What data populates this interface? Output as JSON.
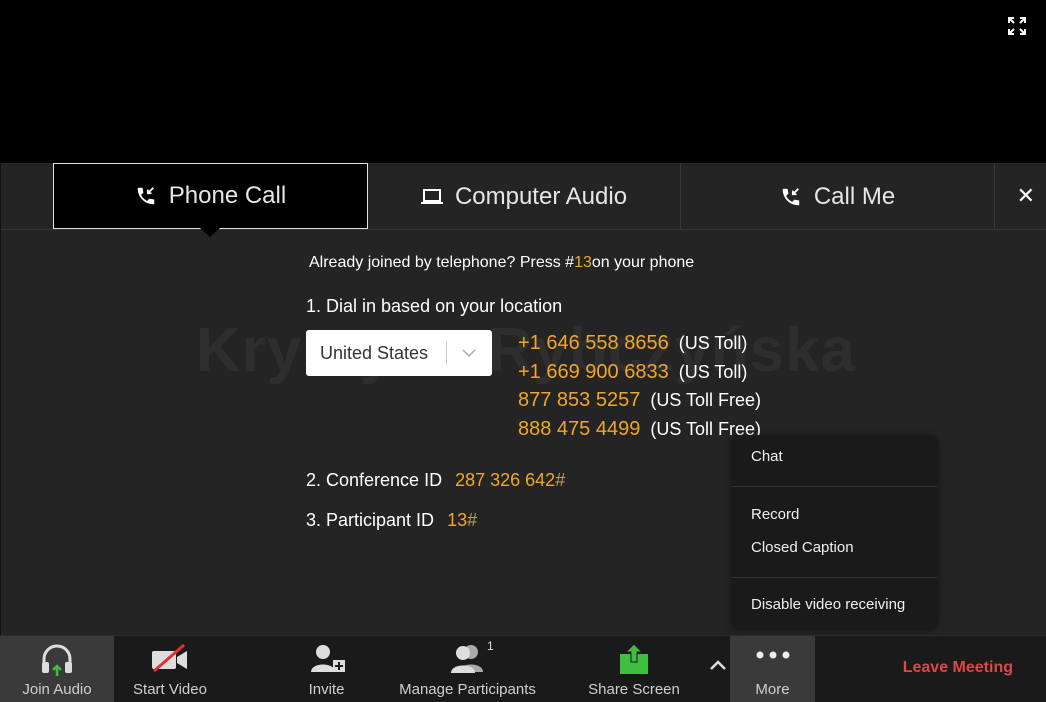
{
  "tabs": {
    "phone_call": "Phone Call",
    "computer_audio": "Computer Audio",
    "call_me": "Call Me"
  },
  "watermark": "Krystyna Rybczyńska",
  "already_joined": {
    "prefix": "Already joined by telephone? Press #",
    "code": "13",
    "suffix": "on your phone"
  },
  "step1": "1. Dial in based on your location",
  "country": "United States",
  "numbers": [
    {
      "number": "+1 646 558 8656",
      "label": "(US Toll)"
    },
    {
      "number": "+1 669 900 6833",
      "label": "(US Toll)"
    },
    {
      "number": "877 853 5257",
      "label": "(US Toll Free)"
    },
    {
      "number": "888 475 4499",
      "label": "(US Toll Free)"
    }
  ],
  "step2": {
    "label": "2. Conference ID",
    "value": "287 326 642",
    "hash": "#"
  },
  "step3": {
    "label": "3. Participant ID",
    "value": "13",
    "hash": "#"
  },
  "toolbar": {
    "join_audio": "Join Audio",
    "start_video": "Start Video",
    "invite": "Invite",
    "manage_participants": "Manage Participants",
    "participants_count": "1",
    "share_screen": "Share Screen",
    "more": "More",
    "leave": "Leave Meeting"
  },
  "more_menu": {
    "chat": "Chat",
    "record": "Record",
    "closed_caption": "Closed Caption",
    "disable_video": "Disable video receiving"
  },
  "colors": {
    "accent_orange": "#f0a62c",
    "leave_red": "#e04848",
    "share_green": "#3fbf3f"
  }
}
